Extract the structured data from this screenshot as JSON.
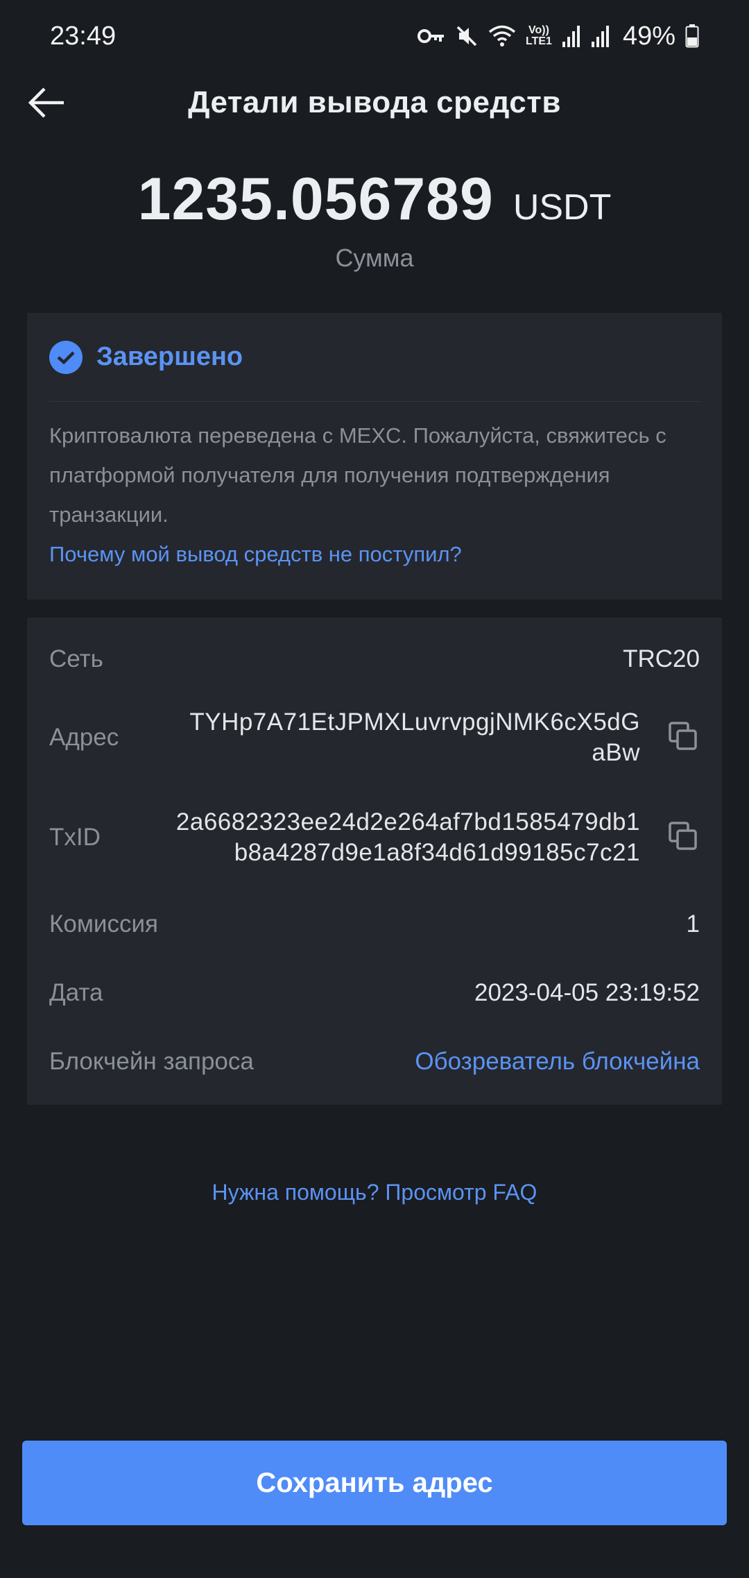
{
  "status_bar": {
    "time": "23:49",
    "battery": "49%",
    "icons": [
      "vpn-key-icon",
      "mute-icon",
      "wifi-icon",
      "volte-icon",
      "signal-icon",
      "signal-icon",
      "battery-icon"
    ],
    "volte_label": "Vo))",
    "lte_label": "LTE1"
  },
  "header": {
    "title": "Детали вывода средств",
    "back_icon": "arrow-left-icon"
  },
  "amount": {
    "value": "1235.056789",
    "currency": "USDT",
    "label": "Сумма"
  },
  "status": {
    "icon": "check-circle-icon",
    "label": "Завершено",
    "description": "Криптовалюта переведена с MEXC. Пожалуйста, свяжитесь с платформой получателя для получения подтверждения транзакции.",
    "link": "Почему мой вывод средств не поступил?"
  },
  "details": {
    "network_label": "Сеть",
    "network_value": "TRC20",
    "address_label": "Адрес",
    "address_line1": "TYHp7A71EtJPMXLuvrvpgjNMK6cX5dG",
    "address_line2": "aBw",
    "txid_label": "TxID",
    "txid_line1": "2a6682323ee24d2e264af7bd1585479db1",
    "txid_line2": "b8a4287d9e1a8f34d61d99185c7c21",
    "fee_label": "Комиссия",
    "fee_value": "1",
    "date_label": "Дата",
    "date_value": "2023-04-05 23:19:52",
    "blockchain_label": "Блокчейн запроса",
    "blockchain_link": "Обозреватель блокчейна"
  },
  "faq_link": "Нужна помощь? Просмотр FAQ",
  "save_button": "Сохранить адрес",
  "colors": {
    "background": "#191c20",
    "card": "#24272d",
    "accent": "#4f8cf7",
    "muted_text": "#8b9099"
  }
}
